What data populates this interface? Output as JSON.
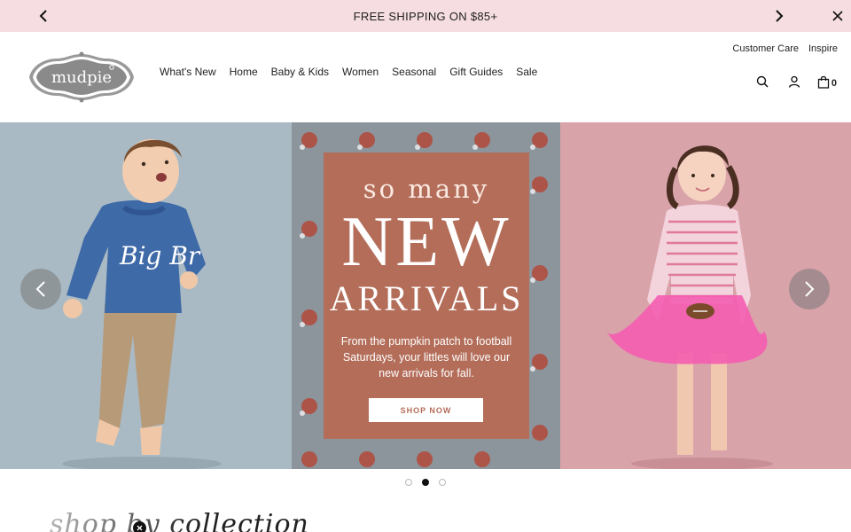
{
  "announcement": {
    "text": "FREE SHIPPING ON $85+"
  },
  "brand": {
    "logo_text": "mudpie"
  },
  "nav": {
    "items": [
      {
        "label": "What's New"
      },
      {
        "label": "Home"
      },
      {
        "label": "Baby & Kids"
      },
      {
        "label": "Women"
      },
      {
        "label": "Seasonal"
      },
      {
        "label": "Gift Guides"
      },
      {
        "label": "Sale"
      }
    ]
  },
  "utility": {
    "customer_care": "Customer Care",
    "inspire": "Inspire"
  },
  "header_icons": {
    "search": "search-icon",
    "account": "user-icon",
    "cart": "shopping-bag-icon",
    "cart_count": "0"
  },
  "hero": {
    "sweater_text": "Big Br",
    "headline_small": "so many",
    "headline_large": "NEW",
    "headline_medium": "ARRIVALS",
    "body": "From the pumpkin patch to football Saturdays, your littles will love our new arrivals for fall.",
    "cta": "SHOP NOW",
    "colors": {
      "left_panel": "#a9bac4",
      "mid_panel": "#8c949c",
      "right_panel": "#d9a3aa",
      "promo_box": "#b36d59"
    }
  },
  "carousel": {
    "slide_count": 3,
    "active_slide": 2
  },
  "section": {
    "script_heading": "shop by collection"
  }
}
